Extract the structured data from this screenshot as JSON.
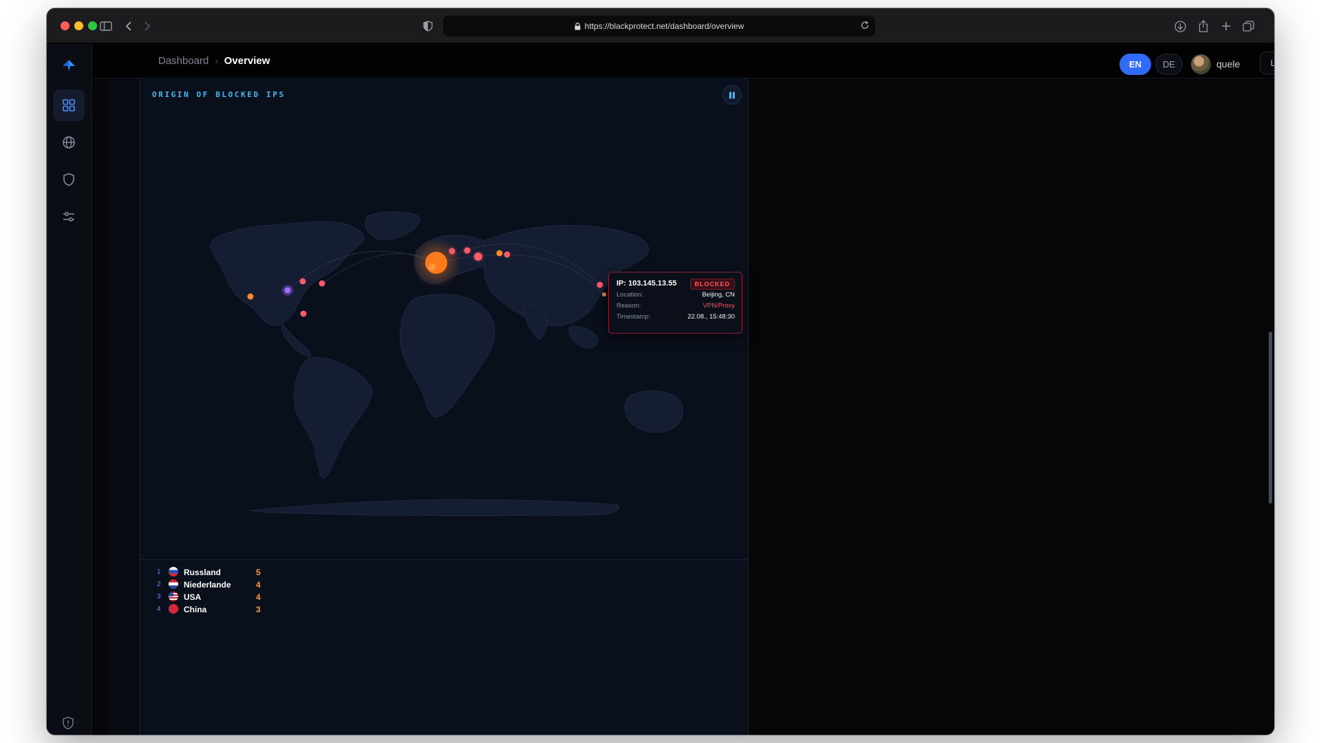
{
  "browser": {
    "url": "https://blackprotect.net/dashboard/overview"
  },
  "header": {
    "breadcrumb_root": "Dashboard",
    "breadcrumb_current": "Overview",
    "lang_en": "EN",
    "lang_de": "DE",
    "username": "quele",
    "logout_label": "Logout"
  },
  "sidebar": {
    "items": [
      {
        "icon": "dashboard-grid-icon",
        "active": true
      },
      {
        "icon": "globe-icon",
        "active": false
      },
      {
        "icon": "shield-icon",
        "active": false
      },
      {
        "icon": "sliders-icon",
        "active": false
      }
    ]
  },
  "map_card": {
    "title": "ORIGIN OF BLOCKED IPS",
    "pause_icon": "pause-icon"
  },
  "tooltip": {
    "ip": "IP: 103.145.13.55",
    "status": "BLOCKED",
    "rows": [
      {
        "key": "Location:",
        "value": "Beijing, CN"
      },
      {
        "key": "Reason:",
        "value": "VPN/Proxy"
      },
      {
        "key": "Timestamp:",
        "value": "22.08., 15:48:30"
      }
    ]
  },
  "ranking": [
    {
      "rank": "1",
      "country": "Russland",
      "count": "5"
    },
    {
      "rank": "2",
      "country": "Niederlande",
      "count": "4"
    },
    {
      "rank": "3",
      "country": "USA",
      "count": "4"
    },
    {
      "rank": "4",
      "country": "China",
      "count": "3"
    }
  ],
  "colors": {
    "accent": "#2f6bff",
    "title": "#46b8f2",
    "blocked": "#ff4f5e",
    "count": "#ff9a3c"
  }
}
